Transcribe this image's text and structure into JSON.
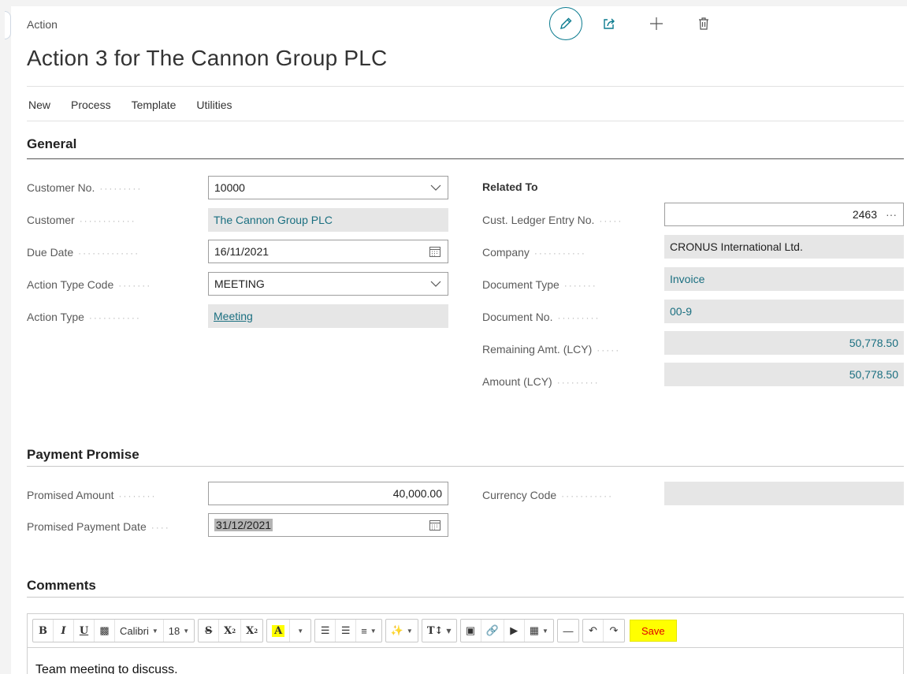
{
  "page": {
    "caption": "Action",
    "title": "Action 3 for The Cannon Group PLC"
  },
  "top_actions": [
    "edit-icon",
    "share-icon",
    "plus-icon",
    "trash-icon"
  ],
  "menu": [
    "New",
    "Process",
    "Template",
    "Utilities"
  ],
  "general": {
    "title": "General",
    "left_fields": [
      {
        "label": "Customer No.",
        "value": "10000",
        "kind": "dropdown"
      },
      {
        "label": "Customer",
        "value": "The Cannon Group PLC",
        "kind": "readonly"
      },
      {
        "label": "Due Date",
        "value": "16/11/2021",
        "kind": "date"
      },
      {
        "label": "Action Type Code",
        "value": "MEETING",
        "kind": "dropdown"
      },
      {
        "label": "Action Type",
        "value": "Meeting",
        "kind": "readonly-link"
      }
    ],
    "related_title": "Related To",
    "right_fields": [
      {
        "label": "Cust. Ledger Entry No.",
        "value": "2463",
        "kind": "lookup"
      },
      {
        "label": "Company",
        "value": "CRONUS International Ltd.",
        "kind": "readonly"
      },
      {
        "label": "Document Type",
        "value": "Invoice",
        "kind": "readonly"
      },
      {
        "label": "Document No.",
        "value": "00-9",
        "kind": "readonly"
      },
      {
        "label": "Remaining Amt. (LCY)",
        "value": "50,778.50",
        "kind": "readonly-number"
      },
      {
        "label": "Amount (LCY)",
        "value": "50,778.50",
        "kind": "readonly-number"
      }
    ]
  },
  "payment_promise": {
    "title": "Payment Promise",
    "promised_amount_label": "Promised Amount",
    "promised_amount": "40,000.00",
    "promised_date_label": "Promised Payment Date",
    "promised_date": "31/12/2021",
    "currency_code_label": "Currency Code",
    "currency_code": ""
  },
  "comments": {
    "title": "Comments",
    "toolbar": {
      "bold": "B",
      "italic": "I",
      "underline": "U",
      "font_name": "Calibri",
      "font_size": "18",
      "strike": "S",
      "superscript": "X",
      "subscript": "X",
      "font_color": "A",
      "save": "Save"
    },
    "body": "Team meeting to discuss."
  },
  "colors": {
    "accent": "#0b7b8f",
    "link": "#1a6f80",
    "readonly_bg": "#e6e6e6",
    "save_bg": "#ffff00",
    "save_text": "#e00000"
  }
}
